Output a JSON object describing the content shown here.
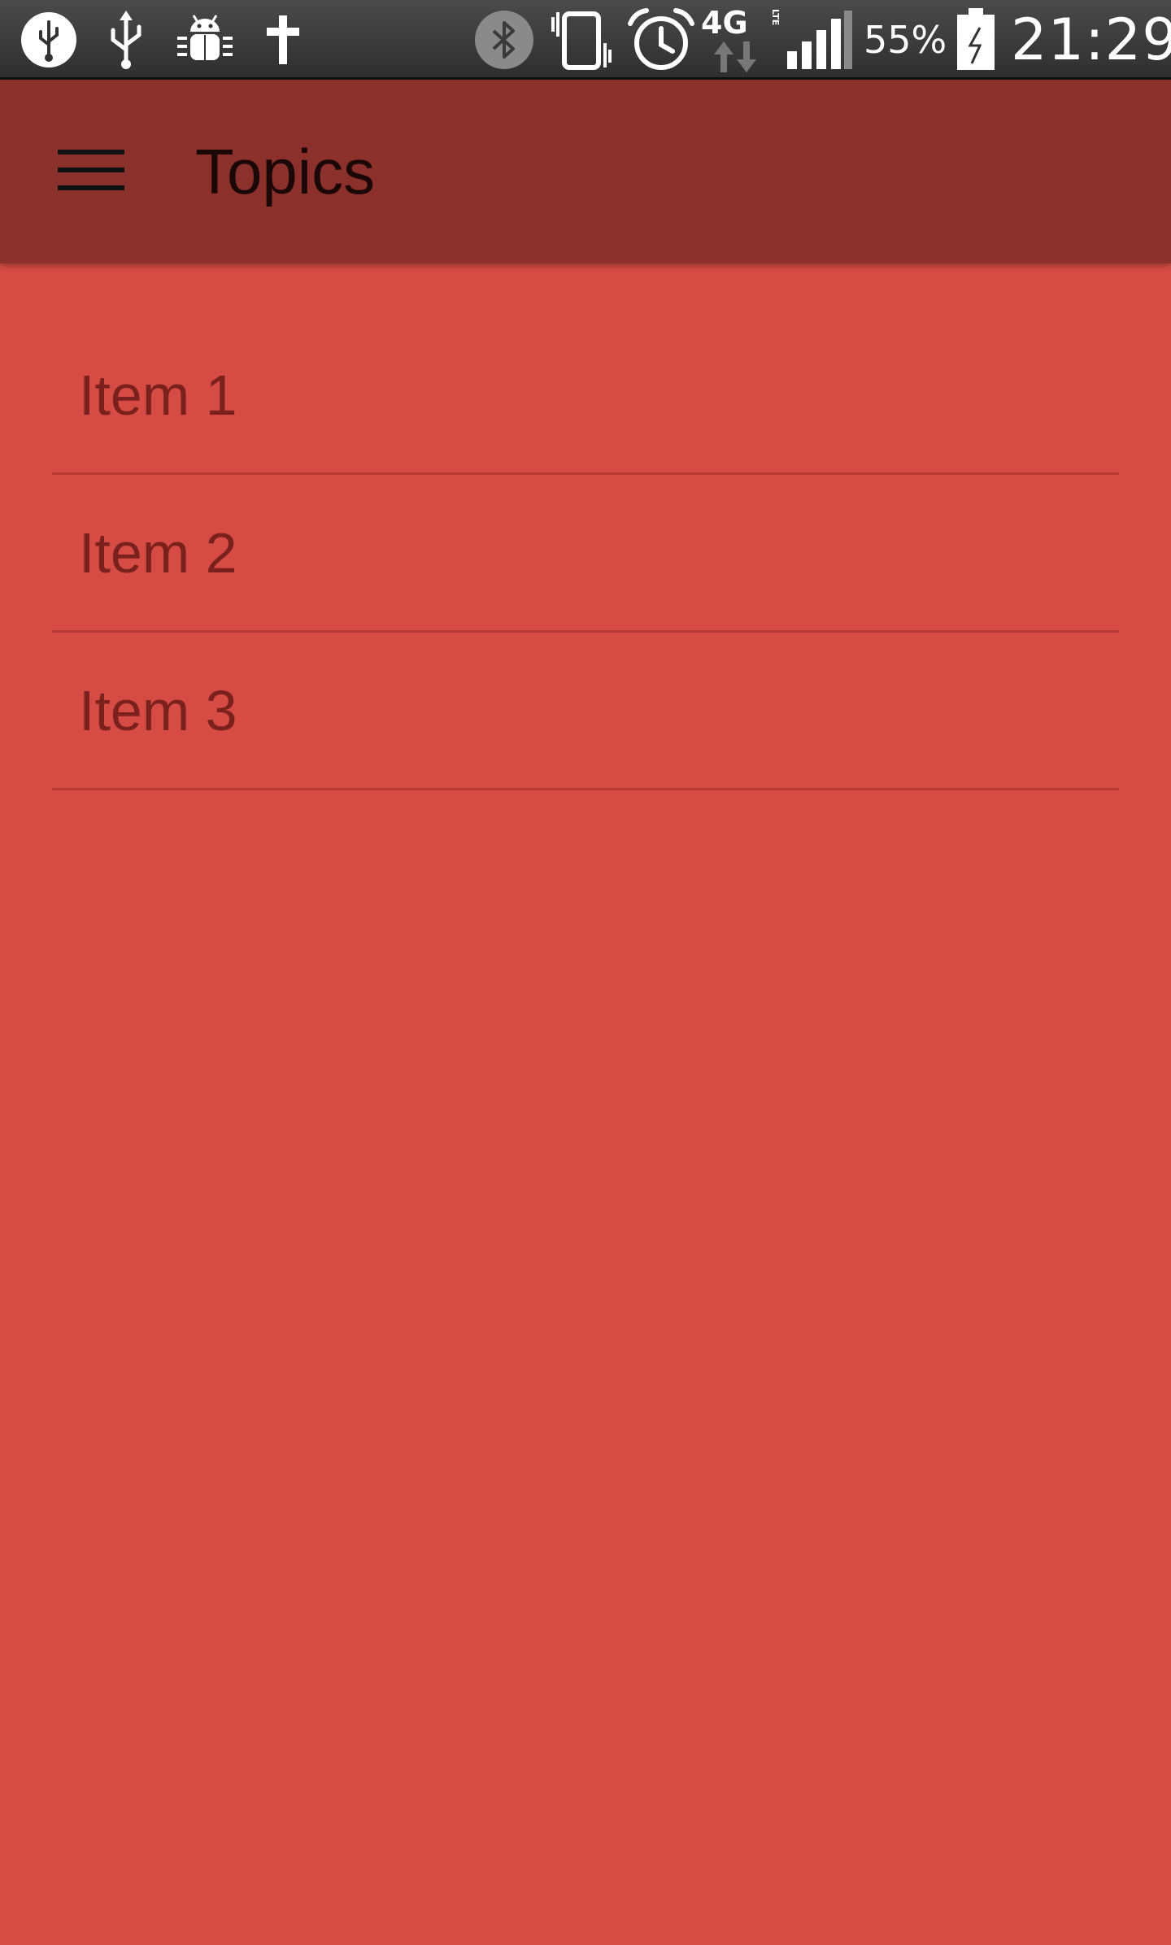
{
  "status_bar": {
    "icons": [
      "usb-debug-icon",
      "usb-icon",
      "android-debug-icon",
      "cross-icon",
      "bluetooth-icon",
      "vibrate-icon",
      "alarm-icon",
      "network-4g-lte-icon",
      "signal-icon",
      "battery-charging-icon"
    ],
    "network_label": "4G",
    "network_sub": "LTE",
    "battery_percent": "55%",
    "clock": "21:29"
  },
  "app_bar": {
    "title": "Topics",
    "menu_icon": "hamburger-menu-icon",
    "color": "#8c302c"
  },
  "list": {
    "items": [
      {
        "label": "Item 1"
      },
      {
        "label": "Item 2"
      },
      {
        "label": "Item 3"
      }
    ]
  },
  "colors": {
    "background": "#d64c44",
    "app_bar": "#8c302c",
    "item_text": "#7a211d",
    "divider": "#b83a34"
  }
}
